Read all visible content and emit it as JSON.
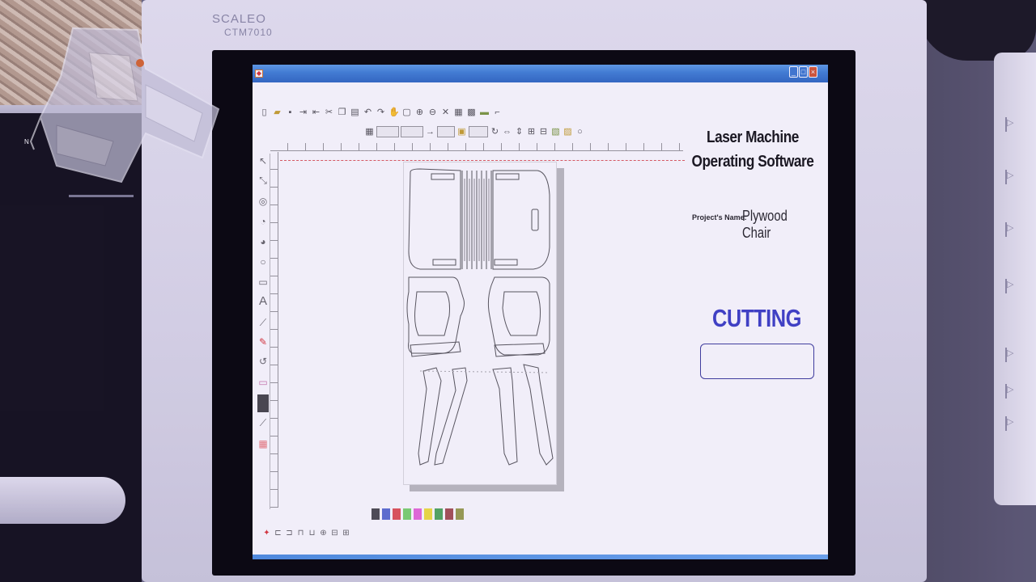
{
  "monitor": {
    "brand": "SCALEO",
    "model": "CTM7010"
  },
  "software": {
    "title_line1": "Laser Machine",
    "title_line2": "Operating Software",
    "project_label": "Project's Name:",
    "project_name": "Plywood Chair",
    "status_text": "CUTTING ...",
    "progress": 0
  },
  "palette": [
    "#4a4a4a",
    "#5b6fd0",
    "#e25252",
    "#7bd66a",
    "#e96ad9",
    "#f2e23a",
    "#4faa5a",
    "#a65050",
    "#9aa04a"
  ],
  "window": {
    "min_glyph": "_",
    "max_glyph": "□",
    "close_glyph": "×"
  },
  "colors": {
    "status": "#3a3ec4",
    "titlebar": "#3d7fd4"
  }
}
